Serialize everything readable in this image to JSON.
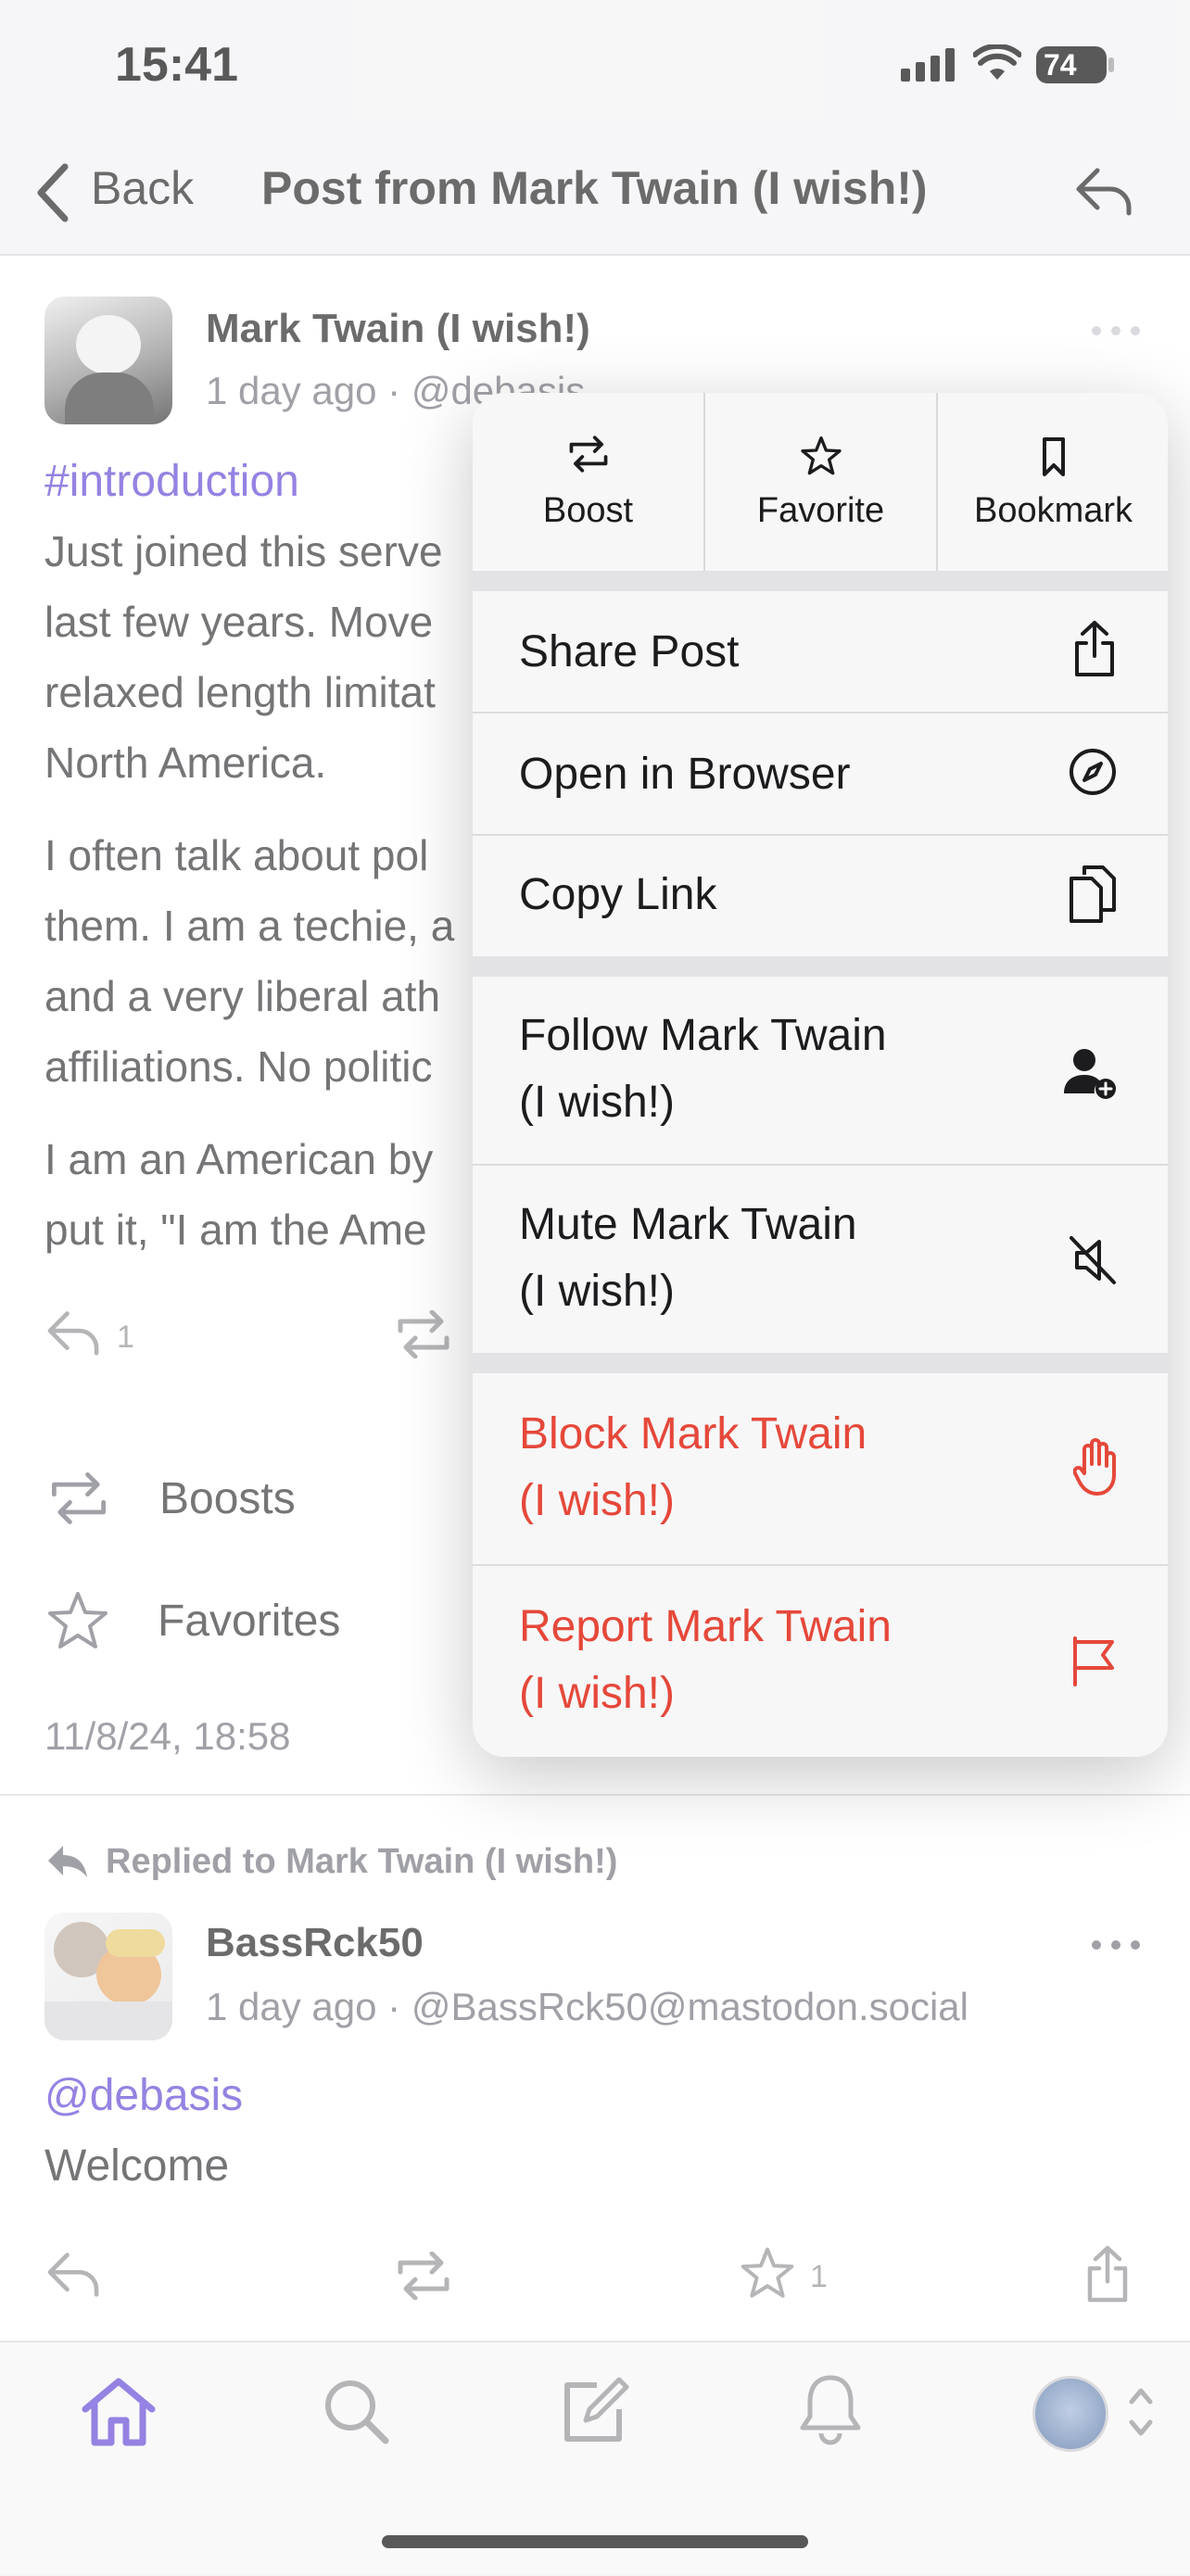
{
  "status_bar": {
    "time": "15:41",
    "battery": "74"
  },
  "nav": {
    "back_label": "Back",
    "title": "Post from Mark Twain (I wish!)"
  },
  "post": {
    "author": "Mark Twain (I wish!)",
    "meta": "1 day ago · @debasis",
    "hashtag": "#introduction",
    "paragraphs": [
      [
        "Just joined this serve",
        "last few years. Move",
        "relaxed length limitat",
        "North America."
      ],
      [
        "I often talk about pol",
        "them. I am a techie, a",
        "and a very liberal ath",
        "affiliations. No politic"
      ],
      [
        "I am an American by",
        "put it, \"I am the Ame"
      ]
    ],
    "reply_count": "1",
    "boosts_label": "Boosts",
    "favorites_label": "Favorites",
    "timestamp": "11/8/24, 18:58"
  },
  "reply": {
    "replied_to": "Replied to Mark Twain (I wish!)",
    "author": "BassRck50",
    "meta": "1 day ago · @BassRck50@mastodon.social",
    "mention": "@debasis",
    "text": "Welcome",
    "favorite_count": "1"
  },
  "menu": {
    "quick_actions": [
      {
        "label": "Boost",
        "icon": "boost-icon"
      },
      {
        "label": "Favorite",
        "icon": "star-icon"
      },
      {
        "label": "Bookmark",
        "icon": "bookmark-icon"
      }
    ],
    "share": "Share Post",
    "open_browser": "Open in Browser",
    "copy_link": "Copy Link",
    "follow": [
      "Follow Mark Twain",
      "(I wish!)"
    ],
    "mute": [
      "Mute Mark Twain",
      "(I wish!)"
    ],
    "block": [
      "Block Mark Twain",
      "(I wish!)"
    ],
    "report": [
      "Report Mark Twain",
      "(I wish!)"
    ]
  },
  "colors": {
    "accent": "#5d3fd3",
    "destructive": "#e5483a"
  }
}
